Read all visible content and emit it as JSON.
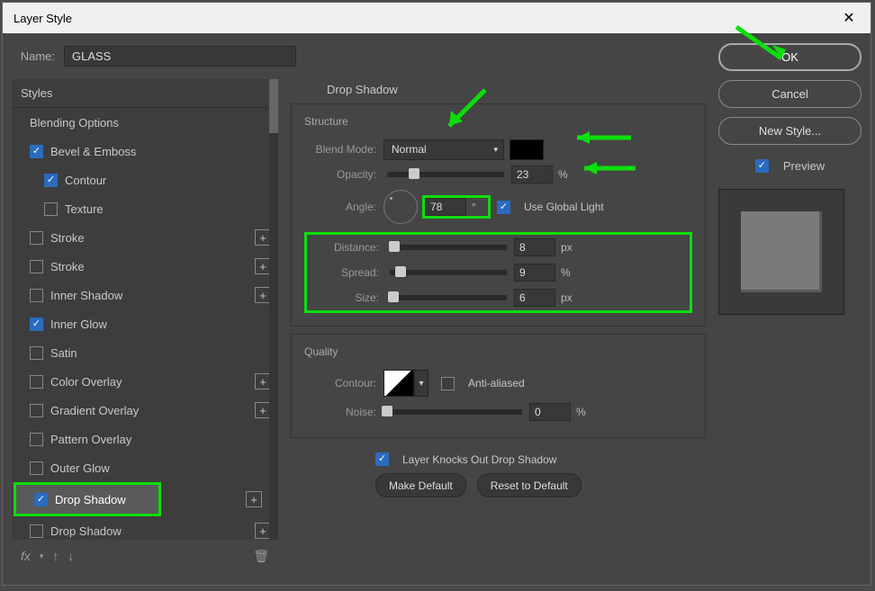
{
  "dialog": {
    "title": "Layer Style"
  },
  "name": {
    "label": "Name:",
    "value": "GLASS"
  },
  "styles": {
    "header": "Styles",
    "items": [
      {
        "label": "Blending Options",
        "checked": null,
        "indent": 1,
        "plus": false
      },
      {
        "label": "Bevel & Emboss",
        "checked": true,
        "indent": 1,
        "plus": false
      },
      {
        "label": "Contour",
        "checked": true,
        "indent": 2,
        "plus": false
      },
      {
        "label": "Texture",
        "checked": false,
        "indent": 2,
        "plus": false
      },
      {
        "label": "Stroke",
        "checked": false,
        "indent": 1,
        "plus": true
      },
      {
        "label": "Stroke",
        "checked": false,
        "indent": 1,
        "plus": true
      },
      {
        "label": "Inner Shadow",
        "checked": false,
        "indent": 1,
        "plus": true
      },
      {
        "label": "Inner Glow",
        "checked": true,
        "indent": 1,
        "plus": false
      },
      {
        "label": "Satin",
        "checked": false,
        "indent": 1,
        "plus": false
      },
      {
        "label": "Color Overlay",
        "checked": false,
        "indent": 1,
        "plus": true
      },
      {
        "label": "Gradient Overlay",
        "checked": false,
        "indent": 1,
        "plus": true
      },
      {
        "label": "Pattern Overlay",
        "checked": false,
        "indent": 1,
        "plus": false
      },
      {
        "label": "Outer Glow",
        "checked": false,
        "indent": 1,
        "plus": false
      },
      {
        "label": "Drop Shadow",
        "checked": true,
        "indent": 1,
        "plus": true,
        "selected": true,
        "highlight": true
      },
      {
        "label": "Drop Shadow",
        "checked": false,
        "indent": 1,
        "plus": true
      }
    ],
    "footer_fx": "fx"
  },
  "dropshadow": {
    "section": "Drop Shadow",
    "structure": {
      "title": "Structure",
      "blend_mode_label": "Blend Mode:",
      "blend_mode_value": "Normal",
      "color": "#000000",
      "opacity_label": "Opacity:",
      "opacity_value": "23",
      "opacity_unit": "%",
      "angle_label": "Angle:",
      "angle_value": "78",
      "angle_unit": "°",
      "global_light_label": "Use Global Light",
      "global_light_checked": true,
      "distance_label": "Distance:",
      "distance_value": "8",
      "distance_unit": "px",
      "spread_label": "Spread:",
      "spread_value": "9",
      "spread_unit": "%",
      "size_label": "Size:",
      "size_value": "6",
      "size_unit": "px"
    },
    "quality": {
      "title": "Quality",
      "contour_label": "Contour:",
      "antialiased_label": "Anti-aliased",
      "antialiased_checked": false,
      "noise_label": "Noise:",
      "noise_value": "0",
      "noise_unit": "%"
    },
    "knockout_label": "Layer Knocks Out Drop Shadow",
    "knockout_checked": true,
    "make_default": "Make Default",
    "reset_default": "Reset to Default"
  },
  "actions": {
    "ok": "OK",
    "cancel": "Cancel",
    "new_style": "New Style...",
    "preview": "Preview",
    "preview_checked": true
  }
}
